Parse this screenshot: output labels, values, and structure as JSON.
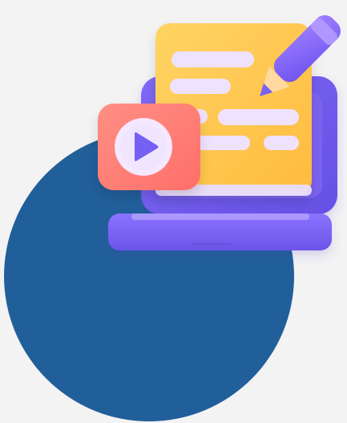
{
  "scene": {
    "background_color": "#f3f3f4",
    "circle_color": "#215f9a",
    "laptop_color": "#7b63ee",
    "laptop_shadow_color": "#5d46cf",
    "document_color": "#ffc34d",
    "text_line_color": "#efe2ff",
    "video_card_color": "#ff7f73",
    "play_button_color": "#f6e8ff",
    "play_icon_color": "#7561f4",
    "pencil_color": "#8a67ff"
  },
  "icons": {
    "video": "play-icon",
    "editing": "pencil-icon",
    "device": "laptop-icon",
    "content": "document-icon"
  }
}
